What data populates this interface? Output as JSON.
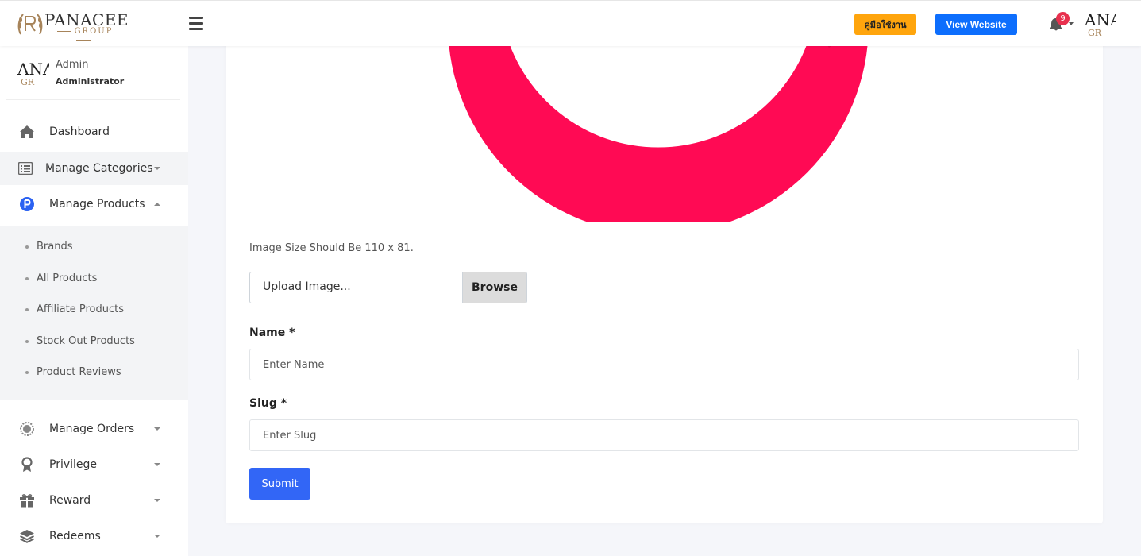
{
  "header": {
    "logo": {
      "name": "PANACEE",
      "sub": "GROUP"
    },
    "manual_button": "คู่มือใช้งาน",
    "view_website_button": "View Website",
    "notification_count": "9",
    "avatar": {
      "line1": "ANA",
      "line2": "GR"
    },
    "colors": {
      "manual": "#ffa50d",
      "view_website": "#0d6efd",
      "badge": "#e8304e"
    }
  },
  "sidebar": {
    "user": {
      "name": "Admin",
      "role": "Administrator",
      "avatar_line1": "ANA",
      "avatar_line2": "GR"
    },
    "items": [
      {
        "label": "Dashboard",
        "icon": "home-icon"
      },
      {
        "label": "Manage Categories",
        "icon": "list-icon"
      },
      {
        "label": "Manage Products",
        "icon": "product-p-icon"
      },
      {
        "label": "Manage Orders",
        "icon": "gear-badge-icon"
      },
      {
        "label": "Privilege",
        "icon": "award-icon"
      },
      {
        "label": "Reward",
        "icon": "gift-icon"
      },
      {
        "label": "Redeems",
        "icon": "layers-icon"
      }
    ],
    "product_submenu": [
      "Brands",
      "All Products",
      "Affiliate Products",
      "Stock Out Products",
      "Product Reviews"
    ]
  },
  "form": {
    "image_hint": "Image Size Should Be 110 x 81.",
    "upload_label": "Upload Image...",
    "browse_label": "Browse",
    "name_label": "Name *",
    "name_placeholder": "Enter Name",
    "slug_label": "Slug *",
    "slug_placeholder": "Enter Slug",
    "submit_label": "Submit",
    "colors": {
      "submit": "#3266f6",
      "preview_ring": "#ff0a54"
    }
  }
}
